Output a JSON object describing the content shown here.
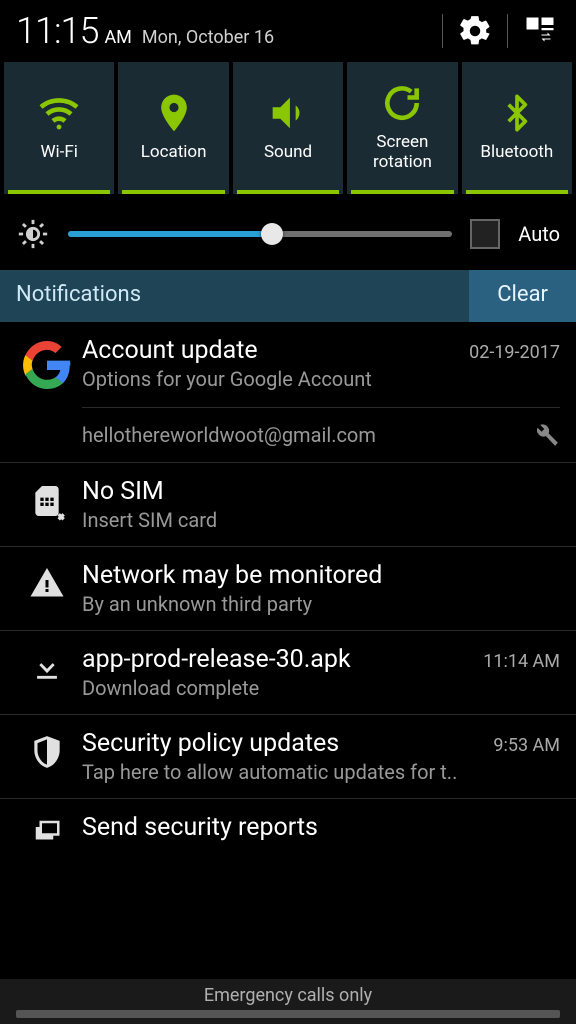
{
  "status": {
    "time": "11:15",
    "ampm": "AM",
    "date": "Mon, October 16"
  },
  "toggles": [
    {
      "label": "Wi-Fi"
    },
    {
      "label": "Location"
    },
    {
      "label": "Sound"
    },
    {
      "label": "Screen\nrotation"
    },
    {
      "label": "Bluetooth"
    }
  ],
  "brightness": {
    "auto_label": "Auto",
    "value": 53
  },
  "notif_header": {
    "title": "Notifications",
    "clear": "Clear"
  },
  "notifications": [
    {
      "title": "Account update",
      "time": "02-19-2017",
      "sub": "Options for your Google Account",
      "detail": "hellothereworldwoot@gmail.com"
    },
    {
      "title": "No SIM",
      "sub": "Insert SIM card"
    },
    {
      "title": "Network may be monitored",
      "sub": "By an unknown third party"
    },
    {
      "title": "app-prod-release-30.apk",
      "time": "11:14 AM",
      "sub": "Download complete"
    },
    {
      "title": "Security policy updates",
      "time": "9:53 AM",
      "sub": "Tap here to allow automatic updates for t.."
    },
    {
      "title": "Send security reports"
    }
  ],
  "footer": {
    "text": "Emergency calls only"
  },
  "colors": {
    "toggle_green": "#8bc700",
    "panel": "#1b2b34",
    "slider_blue": "#2a9fd6",
    "header_teal": "#1e4456",
    "clear_teal": "#2a6180"
  }
}
